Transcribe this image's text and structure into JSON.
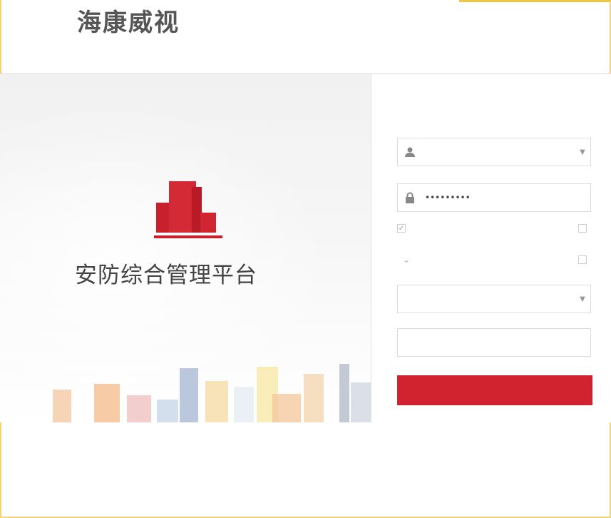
{
  "brand": {
    "name": "海康威视"
  },
  "hero": {
    "title": "安防综合管理平台"
  },
  "login": {
    "welcome_text": "",
    "username": {
      "value": ""
    },
    "password": {
      "value": "•••••••••"
    },
    "remember_password": {
      "label": "",
      "checked": true
    },
    "auto_login": {
      "label": "",
      "checked": false
    },
    "server_type": {
      "value": ""
    },
    "other_option": {
      "label": "",
      "checked": false
    },
    "server_address": {
      "value": ""
    },
    "port": {
      "value": ""
    },
    "submit_label": ""
  },
  "colors": {
    "accent": "#d1232f",
    "frame": "#f3d27a"
  }
}
